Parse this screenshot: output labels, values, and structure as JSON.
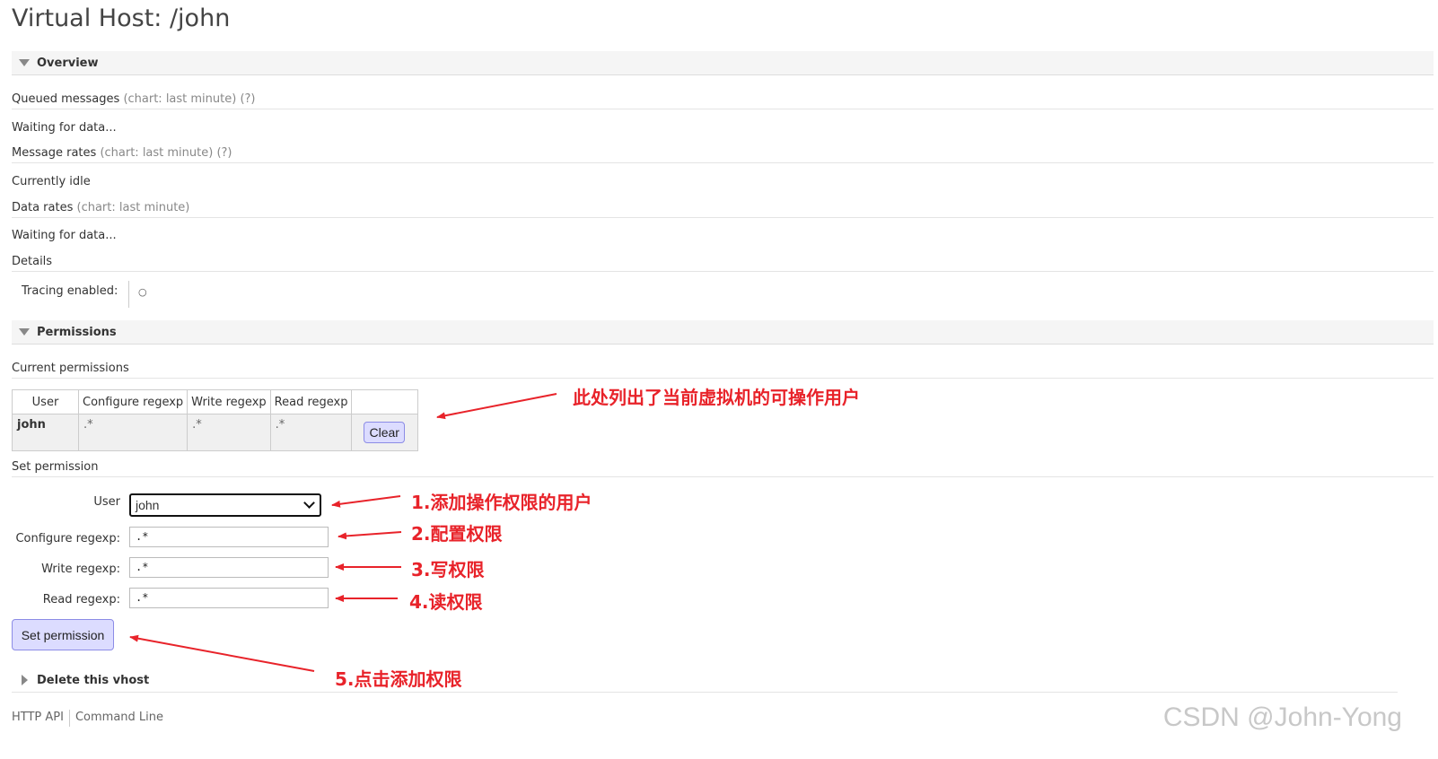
{
  "page": {
    "title": "Virtual Host: /john"
  },
  "overview": {
    "header": "Overview",
    "queued_label": "Queued messages",
    "queued_hint": "(chart: last minute) (?)",
    "queued_status": "Waiting for data...",
    "rates_label": "Message rates",
    "rates_hint": "(chart: last minute) (?)",
    "rates_status": "Currently idle",
    "data_label": "Data rates",
    "data_hint": "(chart: last minute)",
    "data_status": "Waiting for data...",
    "details_label": "Details",
    "tracing_label": "Tracing enabled:",
    "tracing_value": "○"
  },
  "permissions": {
    "header": "Permissions",
    "current_label": "Current permissions",
    "columns": [
      "User",
      "Configure regexp",
      "Write regexp",
      "Read regexp",
      ""
    ],
    "rows": [
      {
        "user": "john",
        "configure": ".*",
        "write": ".*",
        "read": ".*",
        "action": "Clear"
      }
    ],
    "set_label": "Set permission",
    "form": {
      "user_label": "User",
      "user_value": "john",
      "configure_label": "Configure regexp:",
      "configure_value": ".*",
      "write_label": "Write regexp:",
      "write_value": ".*",
      "read_label": "Read regexp:",
      "read_value": ".*",
      "submit": "Set permission"
    }
  },
  "delete_section": {
    "header": "Delete this vhost"
  },
  "footer": {
    "links": [
      "HTTP API",
      "Command Line"
    ]
  },
  "annotations": {
    "users_note": "此处列出了当前虚拟机的可操作用户",
    "step1": "1.添加操作权限的用户",
    "step2": "2.配置权限",
    "step3": "3.写权限",
    "step4": "4.读权限",
    "step5": "5.点击添加权限",
    "color": "#e8232a"
  },
  "watermark": "CSDN @John-Yong"
}
